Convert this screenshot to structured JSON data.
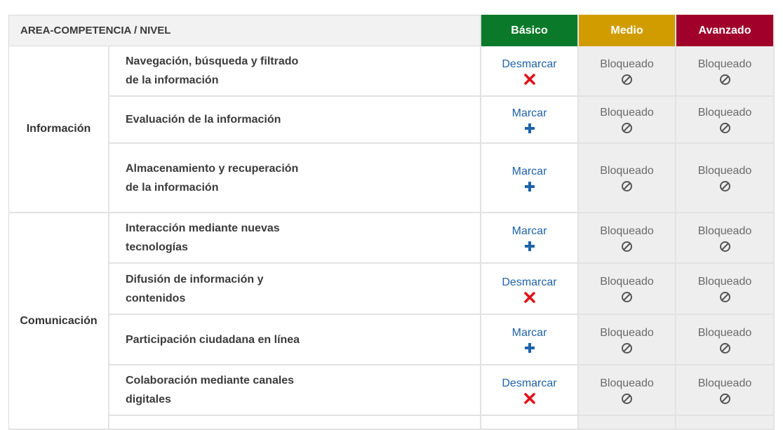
{
  "header": {
    "area_label": "AREA-COMPETENCIA / NIVEL",
    "levels": [
      {
        "label": "Básico",
        "color": "#0a7a2a"
      },
      {
        "label": "Medio",
        "color": "#d19c00"
      },
      {
        "label": "Avanzado",
        "color": "#a0002a"
      }
    ]
  },
  "areas": [
    {
      "label": "Información"
    },
    {
      "label": "Comunicación"
    }
  ],
  "rows": [
    {
      "competence": "Navegación, búsqueda y filtrado de la información",
      "basic_action": "Desmarcar",
      "basic_icon": "close-icon",
      "medio": "Bloqueado",
      "avanzado": "Bloqueado"
    },
    {
      "competence": "Evaluación de la información",
      "basic_action": "Marcar",
      "basic_icon": "plus-icon",
      "medio": "Bloqueado",
      "avanzado": "Bloqueado"
    },
    {
      "competence": "Almacenamiento y recuperación de la información",
      "basic_action": "Marcar",
      "basic_icon": "plus-icon",
      "medio": "Bloqueado",
      "avanzado": "Bloqueado"
    },
    {
      "competence": "Interacción mediante nuevas tecnologías",
      "basic_action": "Marcar",
      "basic_icon": "plus-icon",
      "medio": "Bloqueado",
      "avanzado": "Bloqueado"
    },
    {
      "competence": "Difusión de información y contenidos",
      "basic_action": "Desmarcar",
      "basic_icon": "close-icon",
      "medio": "Bloqueado",
      "avanzado": "Bloqueado"
    },
    {
      "competence": "Participación ciudadana en línea",
      "basic_action": "Marcar",
      "basic_icon": "plus-icon",
      "medio": "Bloqueado",
      "avanzado": "Bloqueado"
    },
    {
      "competence": "Colaboración mediante canales digitales",
      "basic_action": "Desmarcar",
      "basic_icon": "close-icon",
      "medio": "Bloqueado",
      "avanzado": "Bloqueado"
    }
  ],
  "colors": {
    "link": "#1f62a8",
    "unmark_icon": "#e0121a",
    "mark_icon": "#1f62a8",
    "locked_bg": "#eeeeee"
  }
}
